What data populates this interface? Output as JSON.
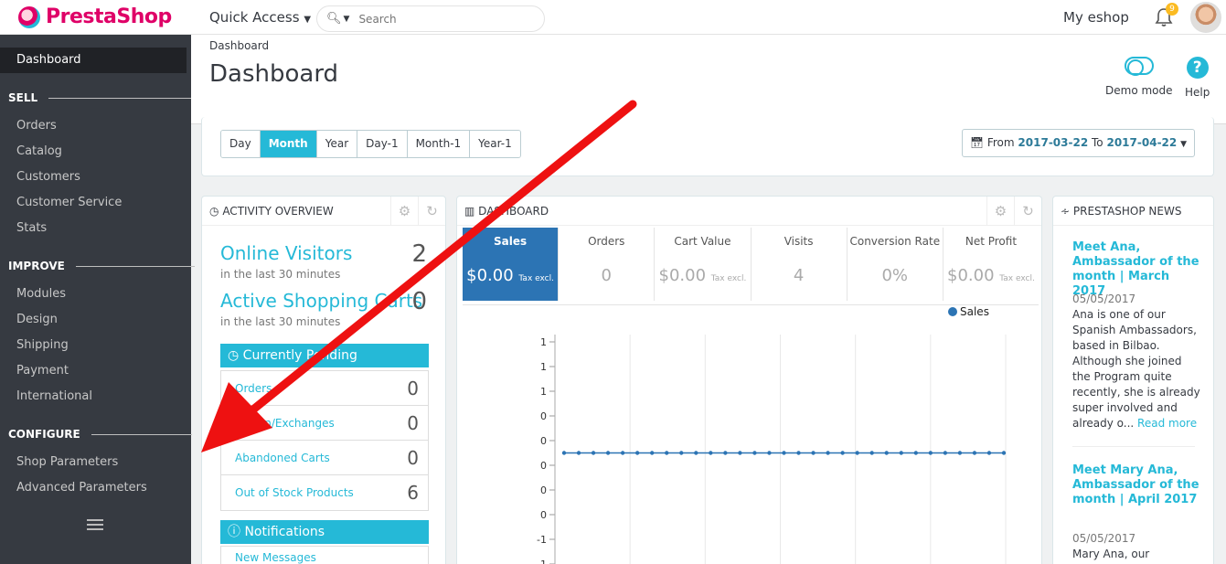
{
  "topbar": {
    "logo_text": "PrestaShop",
    "quick_access": "Quick Access",
    "search_placeholder": "Search",
    "shop_name": "My eshop",
    "notif_count": "9"
  },
  "sidebar": {
    "active": "Dashboard",
    "sections": [
      {
        "title": "SELL",
        "items": [
          "Orders",
          "Catalog",
          "Customers",
          "Customer Service",
          "Stats"
        ]
      },
      {
        "title": "IMPROVE",
        "items": [
          "Modules",
          "Design",
          "Shipping",
          "Payment",
          "International"
        ]
      },
      {
        "title": "CONFIGURE",
        "items": [
          "Shop Parameters",
          "Advanced Parameters"
        ]
      }
    ]
  },
  "header": {
    "breadcrumb": "Dashboard",
    "title": "Dashboard",
    "demo_mode": "Demo mode",
    "help": "Help"
  },
  "period": {
    "buttons": [
      "Day",
      "Month",
      "Year",
      "Day-1",
      "Month-1",
      "Year-1"
    ],
    "active": "Month",
    "range_from_label": "From",
    "range_from": "2017-03-22",
    "range_to_label": "To",
    "range_to": "2017-04-22"
  },
  "activity": {
    "title": "ACTIVITY OVERVIEW",
    "online_visitors": "Online Visitors",
    "online_visitors_value": "2",
    "online_visitors_sub": "in the last 30 minutes",
    "active_carts": "Active Shopping Carts",
    "active_carts_value": "0",
    "active_carts_sub": "in the last 30 minutes",
    "pending_title": "Currently Pending",
    "pending": [
      {
        "label": "Orders",
        "value": "0"
      },
      {
        "label": "Return/Exchanges",
        "value": "0"
      },
      {
        "label": "Abandoned Carts",
        "value": "0"
      },
      {
        "label": "Out of Stock Products",
        "value": "6"
      }
    ],
    "notifications_title": "Notifications",
    "new_messages": "New Messages"
  },
  "dashboard": {
    "title": "DASHBOARD",
    "kpis": [
      {
        "label": "Sales",
        "value": "$0.00",
        "suffix": "Tax excl."
      },
      {
        "label": "Orders",
        "value": "0",
        "suffix": ""
      },
      {
        "label": "Cart Value",
        "value": "$0.00",
        "suffix": "Tax excl."
      },
      {
        "label": "Visits",
        "value": "4",
        "suffix": ""
      },
      {
        "label": "Conversion Rate",
        "value": "0%",
        "suffix": ""
      },
      {
        "label": "Net Profit",
        "value": "$0.00",
        "suffix": "Tax excl."
      }
    ],
    "legend": "Sales"
  },
  "chart_data": {
    "type": "line",
    "title": "",
    "xlabel": "",
    "ylabel": "",
    "ytick_labels": [
      "1",
      "1",
      "1",
      "0",
      "0",
      "0",
      "0",
      "0",
      "-1",
      "-1"
    ],
    "series": [
      {
        "name": "Sales",
        "values": [
          0,
          0,
          0,
          0,
          0,
          0,
          0,
          0,
          0,
          0,
          0,
          0,
          0,
          0,
          0,
          0,
          0,
          0,
          0,
          0,
          0,
          0,
          0,
          0,
          0,
          0,
          0,
          0,
          0,
          0,
          0
        ]
      }
    ],
    "ylim": [
      -1,
      1
    ],
    "grid": true,
    "legend_position": "top-right",
    "series_color": "#2c74b4"
  },
  "news": {
    "title": "PRESTASHOP NEWS",
    "items": [
      {
        "title": "Meet Ana, Ambassador of the month | March 2017",
        "date": "05/05/2017",
        "body": "Ana is one of our Spanish Ambassadors, based in Bilbao. Although she joined the Program quite recently, she is already super involved and already o...",
        "more": "Read more"
      },
      {
        "title": "Meet Mary Ana, Ambassador of the month | April 2017",
        "date": "05/05/2017",
        "body": "Mary Ana, our Ambassador located in"
      }
    ]
  },
  "colors": {
    "accent": "#25b9d7",
    "sidebar_bg": "#363a41",
    "sales_kpi": "#2c74b4",
    "annotation_arrow": "#ee1111"
  }
}
